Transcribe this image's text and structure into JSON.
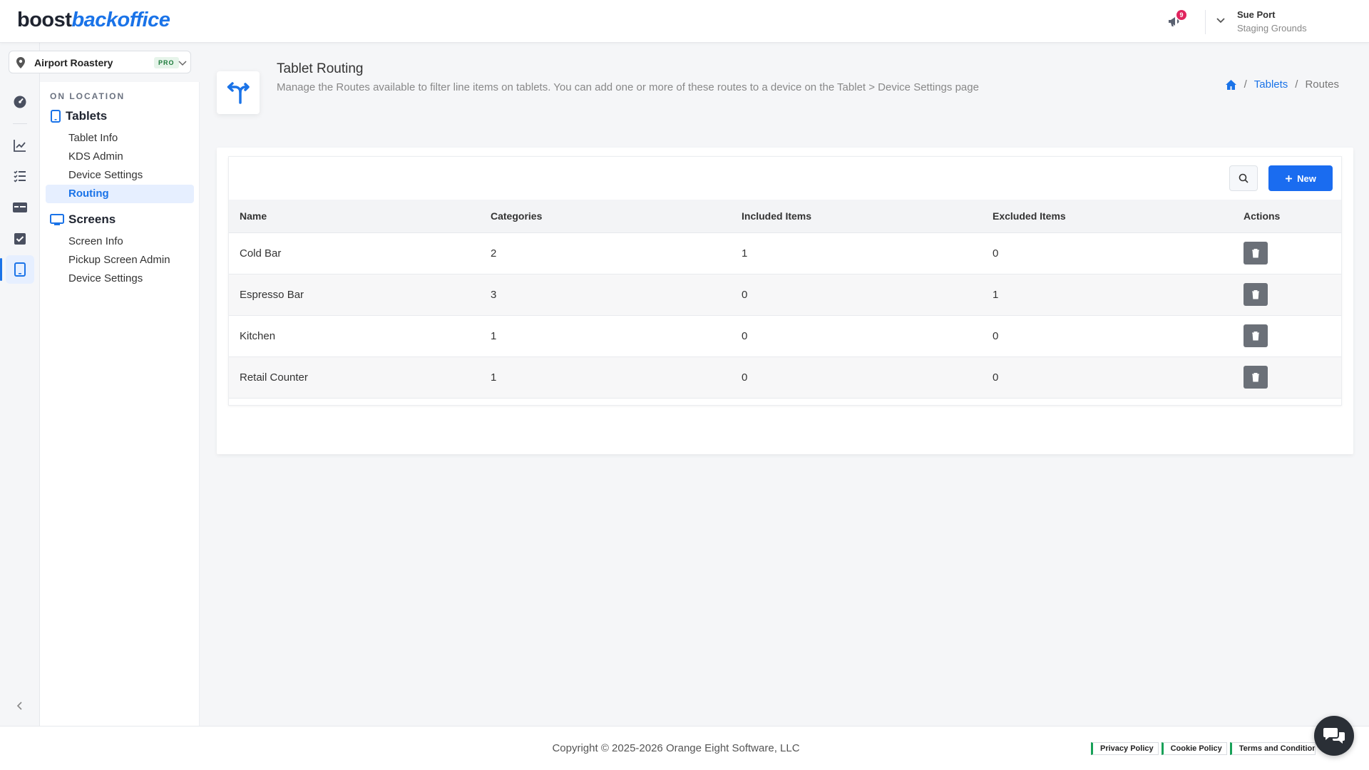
{
  "brand": {
    "part1": "boost",
    "part2": "backoffice"
  },
  "notifications": {
    "count": "9"
  },
  "user": {
    "name": "Sue Port",
    "org": "Staging Grounds"
  },
  "location": {
    "name": "Airport Roastery",
    "badge": "PRO"
  },
  "subnav": {
    "section": "ON LOCATION",
    "groups": [
      {
        "label": "Tablets",
        "items": [
          "Tablet Info",
          "KDS Admin",
          "Device Settings",
          "Routing"
        ]
      },
      {
        "label": "Screens",
        "items": [
          "Screen Info",
          "Pickup Screen Admin",
          "Device Settings"
        ]
      }
    ],
    "active_item": "Routing"
  },
  "page": {
    "title": "Tablet Routing",
    "description": "Manage the Routes available to filter line items on tablets. You can add one or more of these routes to a device on the Tablet > Device Settings page"
  },
  "breadcrumb": {
    "sep": "/",
    "items": [
      "Tablets",
      "Routes"
    ]
  },
  "toolbar": {
    "new_label": "New"
  },
  "table": {
    "columns": [
      "Name",
      "Categories",
      "Included Items",
      "Excluded Items",
      "Actions"
    ],
    "rows": [
      {
        "name": "Cold Bar",
        "categories": "2",
        "included": "1",
        "excluded": "0"
      },
      {
        "name": "Espresso Bar",
        "categories": "3",
        "included": "0",
        "excluded": "1"
      },
      {
        "name": "Kitchen",
        "categories": "1",
        "included": "0",
        "excluded": "0"
      },
      {
        "name": "Retail Counter",
        "categories": "1",
        "included": "0",
        "excluded": "0"
      }
    ]
  },
  "footer": {
    "copyright": "Copyright © 2025-2026 Orange Eight Software, LLC",
    "links": [
      "Privacy Policy",
      "Cookie Policy",
      "Terms and Conditions"
    ]
  },
  "colors": {
    "accent": "#1a73e8",
    "primary_button": "#1a6cf0",
    "delete_button": "#6b7078",
    "pro_badge": "#1b7a3a"
  }
}
